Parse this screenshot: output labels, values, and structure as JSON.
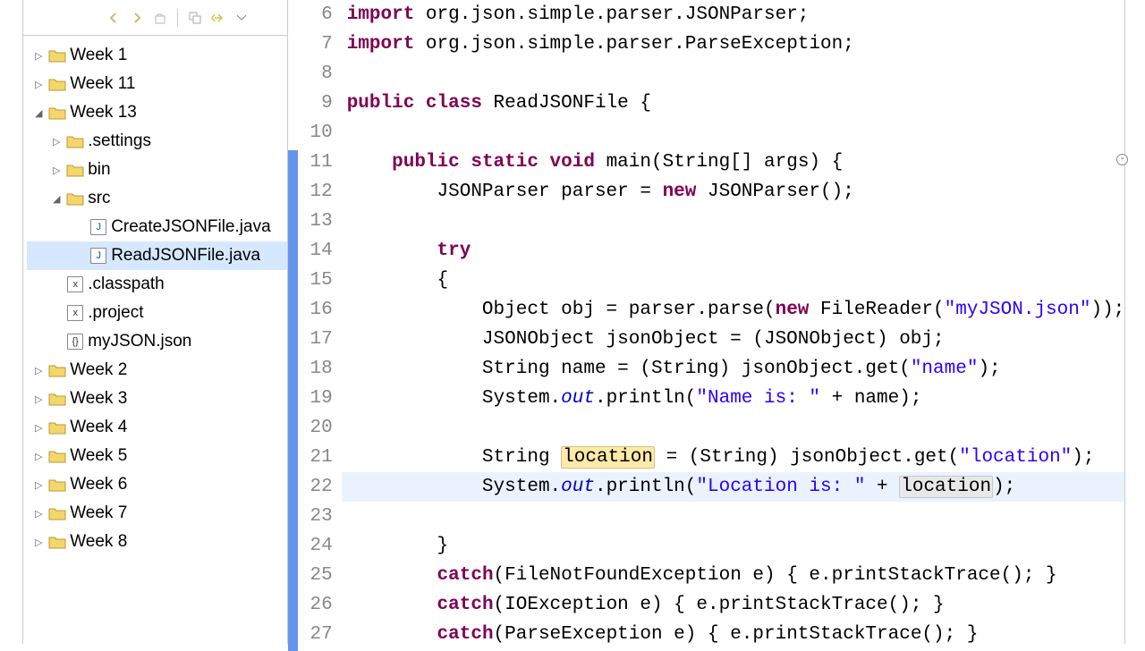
{
  "tree": [
    {
      "label": "Week 1",
      "indent": 0,
      "expanded": false,
      "icon": "project"
    },
    {
      "label": "Week 11",
      "indent": 0,
      "expanded": false,
      "icon": "project"
    },
    {
      "label": "Week 13",
      "indent": 0,
      "expanded": true,
      "icon": "project"
    },
    {
      "label": ".settings",
      "indent": 1,
      "expanded": false,
      "icon": "folder"
    },
    {
      "label": "bin",
      "indent": 1,
      "expanded": false,
      "icon": "folder"
    },
    {
      "label": "src",
      "indent": 1,
      "expanded": true,
      "icon": "folder"
    },
    {
      "label": "CreateJSONFile.java",
      "indent": 2,
      "icon": "java"
    },
    {
      "label": "ReadJSONFile.java",
      "indent": 2,
      "icon": "java",
      "selected": true
    },
    {
      "label": ".classpath",
      "indent": 1,
      "icon": "xml"
    },
    {
      "label": ".project",
      "indent": 1,
      "icon": "xml"
    },
    {
      "label": "myJSON.json",
      "indent": 1,
      "icon": "json"
    },
    {
      "label": "Week 2",
      "indent": 0,
      "expanded": false,
      "icon": "project"
    },
    {
      "label": "Week 3",
      "indent": 0,
      "expanded": false,
      "icon": "project"
    },
    {
      "label": "Week 4",
      "indent": 0,
      "expanded": false,
      "icon": "project"
    },
    {
      "label": "Week 5",
      "indent": 0,
      "expanded": false,
      "icon": "project"
    },
    {
      "label": "Week 6",
      "indent": 0,
      "expanded": false,
      "icon": "project"
    },
    {
      "label": "Week 7",
      "indent": 0,
      "expanded": false,
      "icon": "project"
    },
    {
      "label": "Week 8",
      "indent": 0,
      "expanded": false,
      "icon": "project"
    }
  ],
  "line_numbers": [
    6,
    7,
    8,
    9,
    10,
    11,
    12,
    13,
    14,
    15,
    16,
    17,
    18,
    19,
    20,
    21,
    22,
    23,
    24,
    25,
    26,
    27
  ],
  "current_line": 22,
  "code": {
    "6": [
      {
        "t": "import ",
        "c": "kw"
      },
      {
        "t": "org.json.simple.parser.JSONParser;"
      }
    ],
    "7": [
      {
        "t": "import ",
        "c": "kw"
      },
      {
        "t": "org.json.simple.parser.ParseException;"
      }
    ],
    "8": [
      {
        "t": ""
      }
    ],
    "9": [
      {
        "t": "public class ",
        "c": "kw"
      },
      {
        "t": "ReadJSONFile {"
      }
    ],
    "10": [
      {
        "t": ""
      }
    ],
    "11": [
      {
        "t": "    "
      },
      {
        "t": "public static void ",
        "c": "kw"
      },
      {
        "t": "main(String[] args) {"
      }
    ],
    "12": [
      {
        "t": "        JSONParser parser = "
      },
      {
        "t": "new ",
        "c": "kw"
      },
      {
        "t": "JSONParser();"
      }
    ],
    "13": [
      {
        "t": ""
      }
    ],
    "14": [
      {
        "t": "        "
      },
      {
        "t": "try",
        "c": "kw"
      }
    ],
    "15": [
      {
        "t": "        {"
      }
    ],
    "16": [
      {
        "t": "            Object obj = parser.parse("
      },
      {
        "t": "new ",
        "c": "kw"
      },
      {
        "t": "FileReader("
      },
      {
        "t": "\"myJSON.json\"",
        "c": "str"
      },
      {
        "t": "));"
      }
    ],
    "17": [
      {
        "t": "            JSONObject jsonObject = (JSONObject) obj;"
      }
    ],
    "18": [
      {
        "t": "            String name = (String) jsonObject.get("
      },
      {
        "t": "\"name\"",
        "c": "str"
      },
      {
        "t": ");"
      }
    ],
    "19": [
      {
        "t": "            System."
      },
      {
        "t": "out",
        "c": "field-it"
      },
      {
        "t": ".println("
      },
      {
        "t": "\"Name is: \"",
        "c": "str"
      },
      {
        "t": " + name);"
      }
    ],
    "20": [
      {
        "t": ""
      }
    ],
    "21": [
      {
        "t": "            String "
      },
      {
        "t": "location",
        "c": "hl-yellow"
      },
      {
        "t": " = (String) jsonObject.get("
      },
      {
        "t": "\"location\"",
        "c": "str"
      },
      {
        "t": ");"
      }
    ],
    "22": [
      {
        "t": "            System."
      },
      {
        "t": "out",
        "c": "field-it"
      },
      {
        "t": ".println("
      },
      {
        "t": "\"Location is: \"",
        "c": "str"
      },
      {
        "t": " + "
      },
      {
        "t": "location",
        "c": "hl-grey"
      },
      {
        "t": ");"
      }
    ],
    "23": [
      {
        "t": ""
      }
    ],
    "24": [
      {
        "t": "        }"
      }
    ],
    "25": [
      {
        "t": "        "
      },
      {
        "t": "catch",
        "c": "kw"
      },
      {
        "t": "(FileNotFoundException e) { e.printStackTrace(); }"
      }
    ],
    "26": [
      {
        "t": "        "
      },
      {
        "t": "catch",
        "c": "kw"
      },
      {
        "t": "(IOException e) { e.printStackTrace(); }"
      }
    ],
    "27": [
      {
        "t": "        "
      },
      {
        "t": "catch",
        "c": "kw"
      },
      {
        "t": "(ParseException e) { e.printStackTrace(); }"
      }
    ]
  }
}
